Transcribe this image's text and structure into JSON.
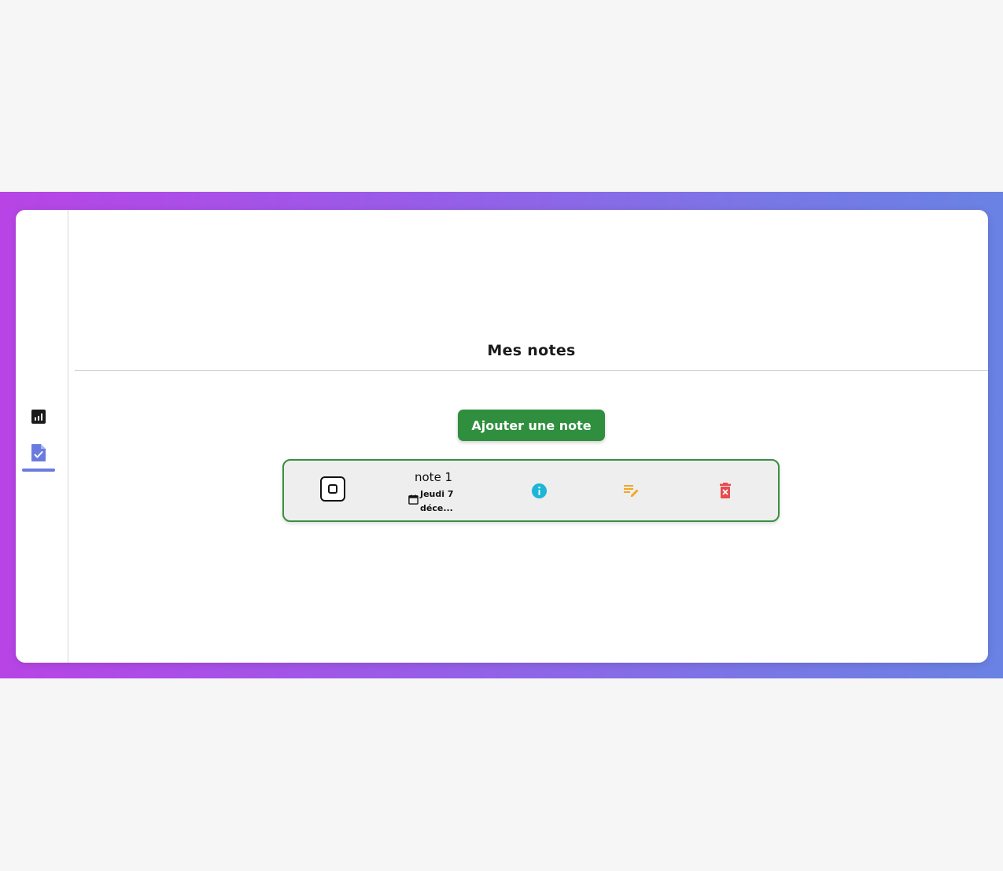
{
  "colors": {
    "accent": "#6a7be0",
    "add_button": "#2f8f3e",
    "note_border": "#3a8f3e",
    "info": "#1db6d6",
    "edit": "#f5a623",
    "delete": "#e84c4c"
  },
  "sidebar": {
    "items": [
      {
        "icon": "bar-chart-icon",
        "active": false
      },
      {
        "icon": "note-check-icon",
        "active": true
      }
    ]
  },
  "main": {
    "title": "Mes notes",
    "add_button_label": "Ajouter une note"
  },
  "notes": [
    {
      "title": "note 1",
      "date": "Jeudi 7 déce...",
      "checked": false
    }
  ],
  "note_actions": [
    "info-icon",
    "edit-icon",
    "delete-icon"
  ]
}
